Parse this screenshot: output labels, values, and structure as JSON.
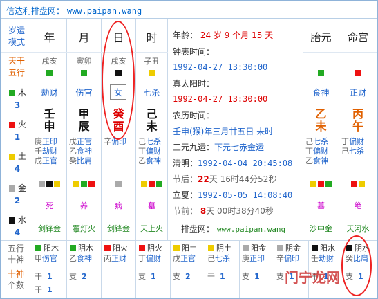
{
  "header": {
    "site": "信达利排盘网：",
    "url": "www.paipan.wang"
  },
  "colors": {
    "wood": "#22aa22",
    "fire": "#ee1111",
    "earth": "#eecc00",
    "metal": "#aaaaaa",
    "water": "#111111",
    "accent": "#2266cc",
    "red": "#dd0000"
  },
  "left": {
    "suiyun": "岁运",
    "moshi": "模式",
    "tiangan": "天干",
    "wuxing": "五行",
    "elements": [
      {
        "name": "木",
        "count": "3",
        "color": "#22aa22"
      },
      {
        "name": "火",
        "count": "1",
        "color": "#ee1111"
      },
      {
        "name": "土",
        "count": "4",
        "color": "#eecc00"
      },
      {
        "name": "金",
        "count": "2",
        "color": "#aaaaaa"
      },
      {
        "name": "水",
        "count": "4",
        "color": "#111111"
      }
    ]
  },
  "pillars": [
    {
      "label": "年",
      "nayin_top": "戌亥",
      "sq": [
        "#22aa22"
      ],
      "shishen": "劫财",
      "gan": "壬",
      "zhi": "申",
      "hide": [
        [
          "庚",
          "正印"
        ],
        [
          "壬",
          "劫财"
        ],
        [
          "戊",
          "正官"
        ]
      ],
      "marks": [
        "#aaaaaa",
        "#111111",
        "#eecc00"
      ],
      "state": "死",
      "nayin": "剑锋金"
    },
    {
      "label": "月",
      "nayin_top": "寅卯",
      "sq": [
        "#22aa22"
      ],
      "shishen": "伤官",
      "gan": "甲",
      "zhi": "辰",
      "hide": [
        [
          "戊",
          "正官"
        ],
        [
          "乙",
          "食神"
        ],
        [
          "癸",
          "比肩"
        ]
      ],
      "marks": [
        "#eecc00",
        "#22aa22",
        "#ee1111"
      ],
      "state": "养",
      "nayin": "覆灯火"
    },
    {
      "label": "日",
      "nayin_top": "戌亥",
      "sq": [
        "#111111"
      ],
      "shishen": "女",
      "gan": "癸",
      "zhi": "酉",
      "hide": [
        [
          "辛",
          "偏印"
        ]
      ],
      "marks": [
        "#aaaaaa"
      ],
      "state": "病",
      "nayin": "剑锋金"
    },
    {
      "label": "时",
      "nayin_top": "子丑",
      "sq": [
        "#eecc00"
      ],
      "shishen": "七杀",
      "gan": "己",
      "zhi": "未",
      "hide": [
        [
          "己",
          "七杀"
        ],
        [
          "丁",
          "偏财"
        ],
        [
          "乙",
          "食神"
        ]
      ],
      "marks": [
        "#eecc00",
        "#ee1111",
        "#22aa22"
      ],
      "state": "墓",
      "nayin": "天上火"
    }
  ],
  "info": {
    "age_label": "年龄：",
    "age": "24",
    "sui": "岁",
    "month": "9",
    "yue": "个月",
    "day": "15",
    "tian": "天",
    "zhongbiao_label": "钟表时间：",
    "zhongbiao": "1992-04-27 13:30:00",
    "zhentaiyang_label": "真太阳时：",
    "zhentaiyang": "1992-04-27 13:30:00",
    "nongli_label": "农历时间：",
    "nongli": "壬申(猴)年三月廿五日 未时",
    "sanyuan_label": "三元九运：",
    "sanyuan": "下元七赤金运",
    "qingming_label": "清明：",
    "qingming": "1992-04-04 20:45:08",
    "jiehou_label": "节后：",
    "jiehou_day": "22",
    "jiehou_tian": "天",
    "jiehou_h": "16",
    "jiehou_m": "44",
    "jiehou_s": "52",
    "jiehou_unit_h": "时",
    "jiehou_unit_m": "分",
    "jiehou_unit_s": "秒",
    "lixia_label": "立夏：",
    "lixia": "1992-05-05 14:08:40",
    "jieqian_label": "节前：",
    "jieqian_day": "8",
    "jieqian_tian": "天",
    "jieqian_h": "00",
    "jieqian_m": "38",
    "jieqian_s": "40",
    "paipan_label": "排盘网：",
    "paipan_url": "www.paipan.wang"
  },
  "taiyuan": {
    "label": "胎元",
    "sq": "#22aa22",
    "shishen": "食神",
    "gan": "乙",
    "zhi": "未",
    "hide": [
      [
        "己",
        "七杀"
      ],
      [
        "丁",
        "偏财"
      ],
      [
        "乙",
        "食神"
      ]
    ],
    "marks": [
      "#eecc00",
      "#ee1111",
      "#22aa22"
    ],
    "state": "墓",
    "nayin": "沙中金"
  },
  "minggong": {
    "label": "命宫",
    "sq": "#ee1111",
    "shishen": "正财",
    "gan": "丙",
    "zhi": "午",
    "hide": [
      [
        "丁",
        "偏财"
      ],
      [
        "己",
        "七杀"
      ]
    ],
    "marks": [
      "#ee1111",
      "#eecc00"
    ],
    "state": "绝",
    "nayin": "天河水"
  },
  "bottom": {
    "left_top": "五行",
    "left_mid": "十神",
    "left_bot1": "十神",
    "left_bot2": "个数",
    "cols": [
      {
        "sq": "#22aa22",
        "yy": "阳木",
        "g": "甲",
        "ss": "伤官",
        "label": "干",
        "cnt": "1"
      },
      {
        "sq": "#22aa22",
        "yy": "阴木",
        "g": "乙",
        "ss": "食神",
        "label": "支",
        "cnt": "2"
      },
      {
        "sq": "#ee1111",
        "yy": "阳火",
        "g": "丙",
        "ss": "正财",
        "label": "",
        "cnt": ""
      },
      {
        "sq": "#ee1111",
        "yy": "阴火",
        "g": "丁",
        "ss": "偏财",
        "label": "支",
        "cnt": "1"
      },
      {
        "sq": "#eecc00",
        "yy": "阳土",
        "g": "戊",
        "ss": "正官",
        "label": "支",
        "cnt": "2"
      },
      {
        "sq": "#eecc00",
        "yy": "阴土",
        "g": "己",
        "ss": "七杀",
        "label": "干",
        "cnt": "1"
      },
      {
        "sq": "#aaaaaa",
        "yy": "阳金",
        "g": "庚",
        "ss": "正印",
        "label": "支",
        "cnt": "1"
      },
      {
        "sq": "#aaaaaa",
        "yy": "阴金",
        "g": "辛",
        "ss": "偏印",
        "label": "支",
        "cnt": "1"
      },
      {
        "sq": "#111111",
        "yy": "阳水",
        "g": "壬",
        "ss": "劫财",
        "label": "干",
        "cnt": "1"
      },
      {
        "sq": "#111111",
        "yy": "阴水",
        "g": "癸",
        "ss": "比肩",
        "label": "支",
        "cnt": "1"
      }
    ],
    "gan_label": "干",
    "gan_cnt": "1"
  },
  "watermark": "门宁龙网"
}
